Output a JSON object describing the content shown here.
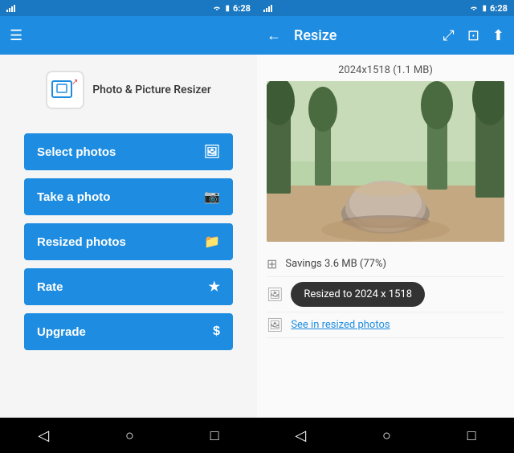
{
  "app": {
    "name": "Photo & Picture Resizer",
    "time": "6:28"
  },
  "left": {
    "buttons": [
      {
        "label": "Select photos",
        "icon": "🖼"
      },
      {
        "label": "Take a photo",
        "icon": "📷"
      },
      {
        "label": "Resized photos",
        "icon": "📁"
      },
      {
        "label": "Rate",
        "icon": "★"
      },
      {
        "label": "Upgrade",
        "icon": "$"
      }
    ]
  },
  "right": {
    "title": "Resize",
    "image_info": "2024x1518 (1.1 MB)",
    "savings": "Savings 3.6 MB (77%)",
    "tooltip": "Resized to 2024 x 1518",
    "link": "See in resized photos"
  },
  "nav": {
    "back": "◁",
    "home": "○",
    "recent": "□"
  }
}
